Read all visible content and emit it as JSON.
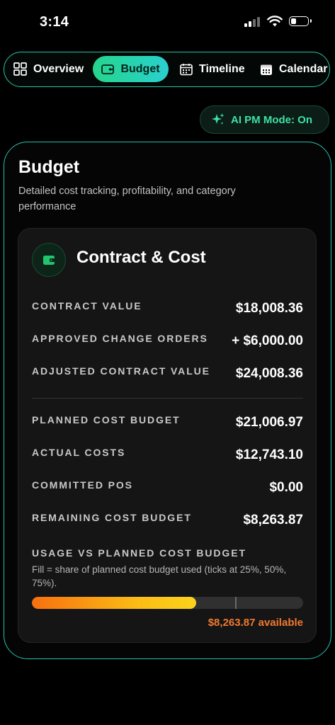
{
  "status_bar": {
    "time": "3:14"
  },
  "nav": {
    "tabs": [
      {
        "label": "Overview",
        "icon": "grid-icon"
      },
      {
        "label": "Budget",
        "icon": "wallet-icon",
        "active": true
      },
      {
        "label": "Timeline",
        "icon": "calendar-grid-icon"
      },
      {
        "label": "Calendar",
        "icon": "calendar-icon"
      }
    ]
  },
  "ai_mode": {
    "label": "AI PM Mode: On",
    "icon": "sparkle-icon"
  },
  "page": {
    "title": "Budget",
    "subtitle": "Detailed cost tracking, profitability, and category performance"
  },
  "card": {
    "title": "Contract & Cost",
    "icon": "wallet-icon",
    "rows": [
      {
        "label": "CONTRACT VALUE",
        "value": "$18,008.36"
      },
      {
        "label": "APPROVED CHANGE ORDERS",
        "value": "+ $6,000.00"
      },
      {
        "label": "ADJUSTED CONTRACT VALUE",
        "value": "$24,008.36"
      },
      {
        "label": "PLANNED COST BUDGET",
        "value": "$21,006.97"
      },
      {
        "label": "ACTUAL COSTS",
        "value": "$12,743.10"
      },
      {
        "label": "COMMITTED POS",
        "value": "$0.00"
      },
      {
        "label": "REMAINING COST BUDGET",
        "value": "$8,263.87"
      }
    ],
    "usage": {
      "label": "USAGE VS PLANNED COST BUDGET",
      "note": "Fill = share of planned cost budget used (ticks at 25%, 50%, 75%).",
      "fill_fraction": 0.607,
      "ticks": [
        0.25,
        0.5,
        0.75
      ],
      "available_text": "$8,263.87 available"
    }
  },
  "colors": {
    "accent_green": "#25d58c",
    "accent_teal": "#2ad0cf",
    "available_orange": "#f0792f",
    "bar_start": "#f7700f",
    "bar_end": "#fcd21c"
  }
}
